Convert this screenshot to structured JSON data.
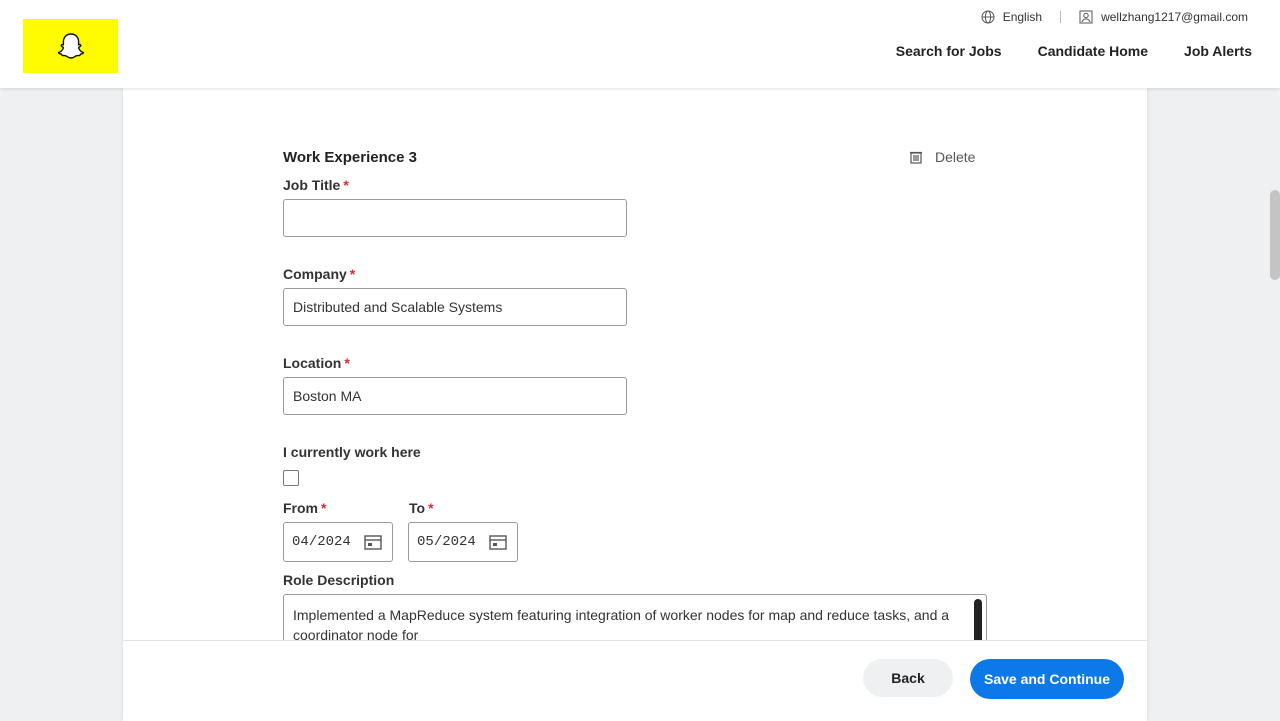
{
  "header": {
    "logo_label": "Snapchat",
    "language": "English",
    "user_email": "wellzhang1217@gmail.com",
    "nav": {
      "search_jobs": "Search for Jobs",
      "candidate_home": "Candidate Home",
      "job_alerts": "Job Alerts"
    }
  },
  "form": {
    "section_title": "Work Experience 3",
    "delete_label": "Delete",
    "job_title": {
      "label": "Job Title",
      "value": ""
    },
    "company": {
      "label": "Company",
      "value": "Distributed and Scalable Systems"
    },
    "location": {
      "label": "Location",
      "value": "Boston MA"
    },
    "currently_work_here": {
      "label": "I currently work here",
      "checked": false
    },
    "from": {
      "label": "From",
      "month": "04",
      "year": "2024"
    },
    "to": {
      "label": "To",
      "month": "05",
      "year": "2024"
    },
    "description": {
      "label": "Role Description",
      "value": "Implemented a MapReduce system featuring integration of worker nodes for map and reduce tasks, and a coordinator node for"
    },
    "required_mark": "*"
  },
  "footer": {
    "back_label": "Back",
    "save_label": "Save and Continue"
  },
  "colors": {
    "brand_yellow": "#fffc00",
    "primary_blue": "#0d79e8",
    "required_red": "#e0262f"
  }
}
